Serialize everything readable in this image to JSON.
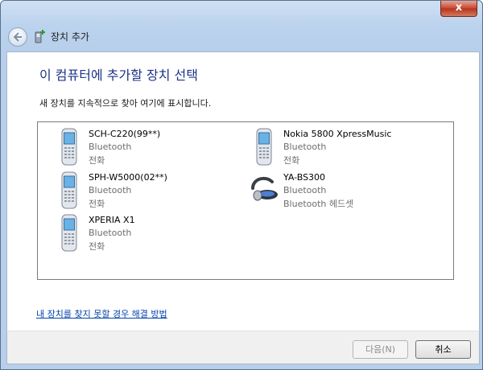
{
  "window": {
    "close_glyph": "x"
  },
  "titlebar": {
    "title": "장치 추가",
    "back_icon": "back-arrow-icon",
    "title_icon": "add-device-icon"
  },
  "main": {
    "heading": "이 컴퓨터에 추가할 장치 선택",
    "subtitle": "새 장치를 지속적으로 찾아 여기에 표시합니다."
  },
  "devices": [
    {
      "name": "SCH-C220(99**)",
      "type": "Bluetooth",
      "category": "전화",
      "icon": "phone-icon"
    },
    {
      "name": "Nokia 5800 XpressMusic",
      "type": "Bluetooth",
      "category": "전화",
      "icon": "phone-icon"
    },
    {
      "name": "SPH-W5000(02**)",
      "type": "Bluetooth",
      "category": "전화",
      "icon": "phone-icon"
    },
    {
      "name": "YA-BS300",
      "type": "Bluetooth",
      "category": "Bluetooth 헤드셋",
      "icon": "headset-icon"
    },
    {
      "name": "XPERIA X1",
      "type": "Bluetooth",
      "category": "전화",
      "icon": "phone-icon"
    }
  ],
  "help_link": "내 장치를 찾지 못할 경우 해결 방법",
  "footer": {
    "next_label": "다음(N)",
    "cancel_label": "취소"
  }
}
